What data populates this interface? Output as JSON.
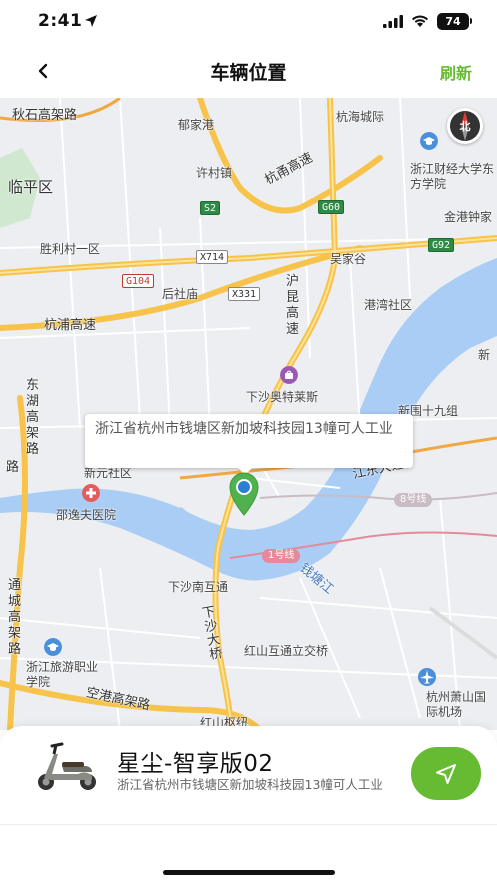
{
  "status_bar": {
    "time": "2:41",
    "battery": "74"
  },
  "header": {
    "title": "车辆位置",
    "refresh_label": "刷新",
    "back_icon": "chevron-left-icon"
  },
  "map": {
    "compass_label": "北",
    "address_bubble": "浙江省杭州市钱塘区新加坡科技园13幢可人工业",
    "labels": {
      "qiushi_road": "秋石高架路",
      "yujia_gang": "郁家港",
      "hanghai_city": "杭海城际",
      "linping": "临平区",
      "xucun": "许村镇",
      "hangyong": "杭甬高速",
      "zufe": "浙江财经大学东方学院",
      "jinggang": "金港钟家",
      "shengli": "胜利村一区",
      "wujiagu": "吴家谷",
      "houshemiao": "后社庙",
      "gangwan": "港湾社区",
      "hangpu": "杭浦高速",
      "huhang": "沪昆高速",
      "xin": "新",
      "outlets": "下沙奥特莱斯",
      "donghu": "东湖高架路",
      "xinwei": "新围十九组",
      "jiangdong": "江东大道",
      "xinyuan": "新元社区",
      "shaoyifu": "邵逸夫医院",
      "xiasha_south": "下沙南互通",
      "xiasha_bridge": "下沙大桥",
      "qiantang_river": "钱塘江",
      "tongcheng": "通城高架路",
      "hongshan": "红山互通立交桥",
      "lvyou": "浙江旅游职业学院",
      "konggang": "空港高架路",
      "airport": "杭州萧山国际机场",
      "hongshan_bottom": "红山枢纽",
      "lu": "路"
    },
    "shields": {
      "s2": "S2",
      "g60": "G60",
      "x714": "X714",
      "g92": "G92",
      "g104": "G104",
      "x331": "X331"
    },
    "metro": {
      "line1": "1号线",
      "line8": "8号线"
    }
  },
  "vehicle": {
    "name": "星尘-智享版02",
    "address": "浙江省杭州市钱塘区新加坡科技园13幢可人工业"
  },
  "colors": {
    "accent": "#66bb33",
    "water": "#a9cdf5",
    "highway": "#f7c34a",
    "pin": "#4fb24f",
    "pin_dot": "#2a7fd4"
  }
}
